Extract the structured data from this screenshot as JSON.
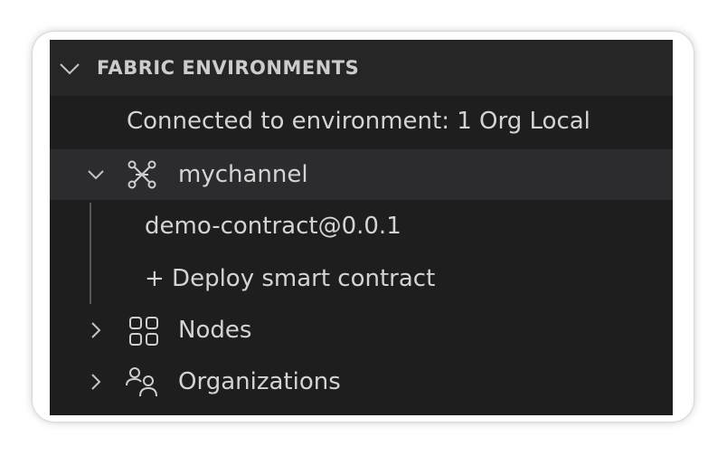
{
  "section": {
    "title": "FABRIC ENVIRONMENTS"
  },
  "tree": {
    "connected_label": "Connected to environment: 1 Org Local",
    "channel": {
      "label": "mychannel",
      "icon": "network-graph-icon",
      "expanded": true,
      "children": [
        {
          "label": "demo-contract@0.0.1"
        },
        {
          "label": "+ Deploy smart contract"
        }
      ]
    },
    "nodes": {
      "label": "Nodes",
      "icon": "grid-icon",
      "expanded": false
    },
    "organizations": {
      "label": "Organizations",
      "icon": "people-icon",
      "expanded": false
    }
  },
  "colors": {
    "panel_bg": "#1e1e1e",
    "header_bg": "#262626",
    "selected_bg": "#2c2c2e",
    "text": "#d4d4d4"
  }
}
